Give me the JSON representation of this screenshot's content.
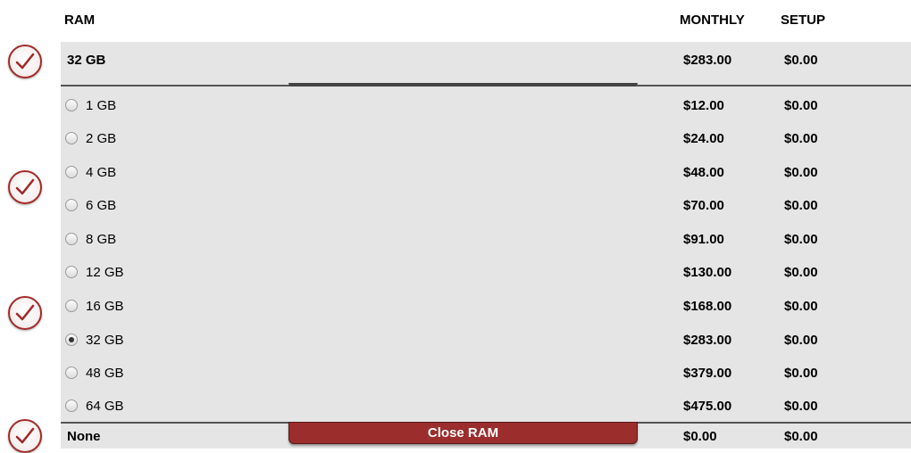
{
  "header": {
    "ram_label": "RAM",
    "monthly_label": "MONTHLY",
    "setup_label": "SETUP"
  },
  "selected": {
    "label": "32 GB",
    "monthly": "$283.00",
    "setup": "$0.00"
  },
  "options": [
    {
      "label": "1 GB",
      "monthly": "$12.00",
      "setup": "$0.00",
      "checked": false
    },
    {
      "label": "2 GB",
      "monthly": "$24.00",
      "setup": "$0.00",
      "checked": false
    },
    {
      "label": "4 GB",
      "monthly": "$48.00",
      "setup": "$0.00",
      "checked": false
    },
    {
      "label": "6 GB",
      "monthly": "$70.00",
      "setup": "$0.00",
      "checked": false
    },
    {
      "label": "8 GB",
      "monthly": "$91.00",
      "setup": "$0.00",
      "checked": false
    },
    {
      "label": "12 GB",
      "monthly": "$130.00",
      "setup": "$0.00",
      "checked": false
    },
    {
      "label": "16 GB",
      "monthly": "$168.00",
      "setup": "$0.00",
      "checked": false
    },
    {
      "label": "32 GB",
      "monthly": "$283.00",
      "setup": "$0.00",
      "checked": true
    },
    {
      "label": "48 GB",
      "monthly": "$379.00",
      "setup": "$0.00",
      "checked": false
    },
    {
      "label": "64 GB",
      "monthly": "$475.00",
      "setup": "$0.00",
      "checked": false
    }
  ],
  "next_section": {
    "label": "None",
    "monthly": "$0.00",
    "setup": "$0.00"
  },
  "close_button_label": "Close RAM",
  "colors": {
    "accent": "#9b2d2d",
    "panel_bg": "#e5e5e5",
    "check_icon": "#a32a2a"
  },
  "icons": {
    "status": "checkmark-circle-icon",
    "option": "radio-button"
  }
}
